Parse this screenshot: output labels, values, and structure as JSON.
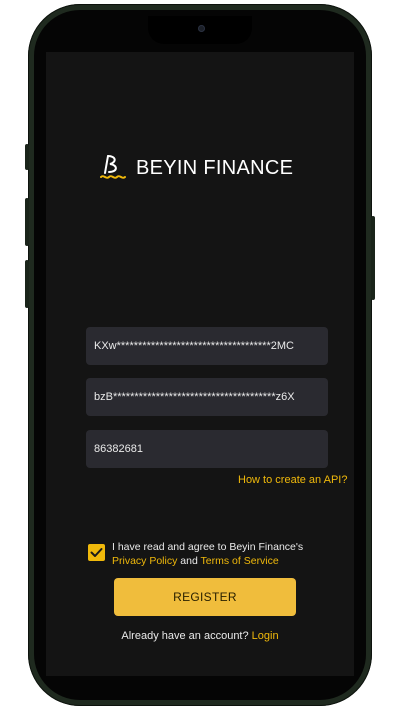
{
  "app": {
    "name": "BEYIN FINANCE"
  },
  "form": {
    "api_key": "KXw************************************2MC",
    "api_secret": "bzB**************************************z6X",
    "passphrase": "86382681",
    "api_help_link": "How to create an API?"
  },
  "agreement": {
    "checked": true,
    "text_prefix": "I have read and agree to Beyin Finance's",
    "privacy_policy": "Privacy Policy",
    "and": "and",
    "terms_of_service": "Terms of Service"
  },
  "actions": {
    "register_label": "REGISTER",
    "already_text": "Already have an account?",
    "login_link": "Login"
  },
  "colors": {
    "accent": "#f0b90b",
    "button": "#f0bd3c",
    "screen_bg": "#141414",
    "field_bg": "#2a2a30"
  },
  "icons": {
    "logo": "beyin-logo-icon",
    "checkbox": "check-icon"
  }
}
